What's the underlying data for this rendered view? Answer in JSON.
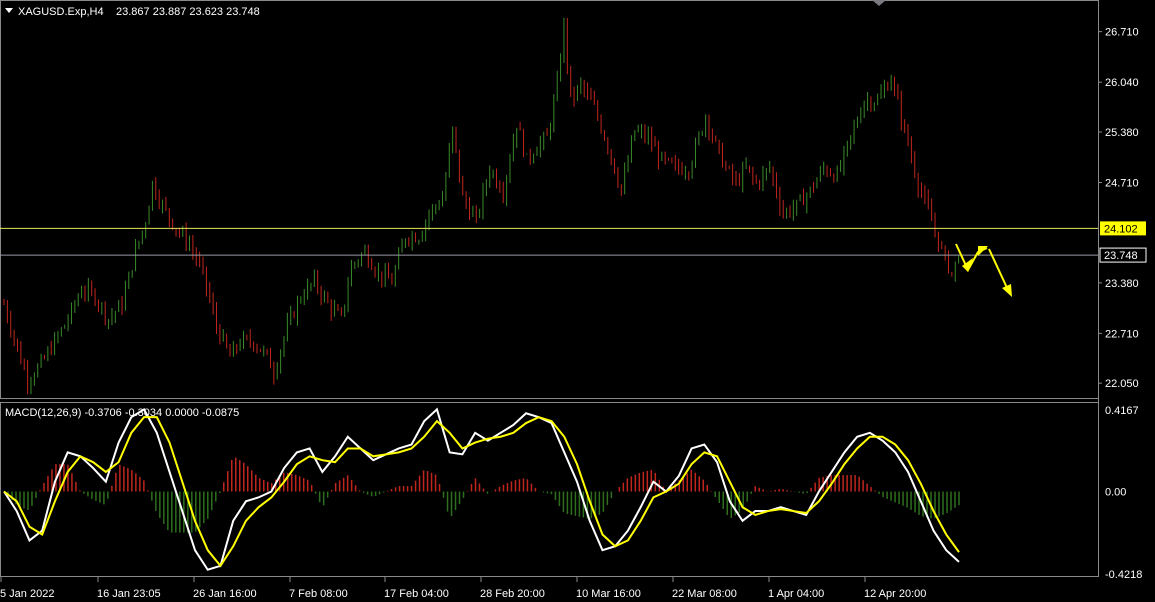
{
  "header": {
    "symbol_timeframe": "XAGUSD.Exp,H4",
    "ohlc": "23.867 23.887 23.623 23.748"
  },
  "macd_header": {
    "label": "MACD(12,26,9) -0.3706 -0.3034 0.0000 -0.0875"
  },
  "colors": {
    "background": "#000000",
    "bull_candle": "#3a8a2a",
    "bear_candle": "#c0261e",
    "hline_yellow": "#e6e65a",
    "hline_grey": "#9a9aa6",
    "macd_line": "#ffffff",
    "signal_line": "#ffff00",
    "hist_pos": "#c0261e",
    "hist_neg": "#2e6e1e",
    "arrow": "#ffff00"
  },
  "price_tags": {
    "yellow_level": "24.102",
    "current_price": "23.748"
  },
  "chart_data": [
    {
      "type": "candlestick",
      "name": "XAGUSD.Exp,H4",
      "yticks": [
        "26.710",
        "26.040",
        "25.380",
        "24.710",
        "23.380",
        "22.710",
        "22.050"
      ],
      "ylim": [
        21.88,
        27.05
      ],
      "xticks": [
        "5 Jan 2022",
        "16 Jan 23:05",
        "26 Jan 16:00",
        "7 Feb 08:00",
        "17 Feb 04:00",
        "28 Feb 20:00",
        "10 Mar 16:00",
        "22 Mar 08:00",
        "1 Apr 04:00",
        "12 Apr 20:00"
      ],
      "close_path": [
        [
          0,
          23.1
        ],
        [
          4,
          22.5
        ],
        [
          7,
          22.1
        ],
        [
          11,
          22.3
        ],
        [
          15,
          22.6
        ],
        [
          19,
          22.9
        ],
        [
          23,
          23.3
        ],
        [
          27,
          23.2
        ],
        [
          31,
          22.9
        ],
        [
          35,
          23.1
        ],
        [
          39,
          23.8
        ],
        [
          42,
          24.2
        ],
        [
          44,
          24.7
        ],
        [
          47,
          24.4
        ],
        [
          51,
          24.1
        ],
        [
          55,
          23.9
        ],
        [
          59,
          23.5
        ],
        [
          63,
          22.8
        ],
        [
          67,
          22.4
        ],
        [
          70,
          22.6
        ],
        [
          74,
          22.6
        ],
        [
          78,
          22.4
        ],
        [
          80,
          22.2
        ],
        [
          84,
          22.8
        ],
        [
          88,
          23.2
        ],
        [
          92,
          23.4
        ],
        [
          96,
          23.1
        ],
        [
          100,
          22.9
        ],
        [
          103,
          23.6
        ],
        [
          107,
          23.8
        ],
        [
          111,
          23.5
        ],
        [
          115,
          23.4
        ],
        [
          119,
          24.0
        ],
        [
          123,
          24.0
        ],
        [
          126,
          24.3
        ],
        [
          130,
          24.5
        ],
        [
          133,
          25.4
        ],
        [
          136,
          24.5
        ],
        [
          140,
          24.2
        ],
        [
          144,
          24.9
        ],
        [
          148,
          24.6
        ],
        [
          152,
          25.5
        ],
        [
          155,
          25.0
        ],
        [
          158,
          25.2
        ],
        [
          161,
          25.3
        ],
        [
          164,
          26.0
        ],
        [
          166,
          26.8
        ],
        [
          168,
          25.8
        ],
        [
          171,
          26.0
        ],
        [
          175,
          25.7
        ],
        [
          179,
          25.2
        ],
        [
          183,
          24.6
        ],
        [
          187,
          25.4
        ],
        [
          191,
          25.3
        ],
        [
          195,
          25.0
        ],
        [
          199,
          24.9
        ],
        [
          203,
          24.9
        ],
        [
          206,
          25.3
        ],
        [
          208,
          25.6
        ],
        [
          211,
          25.2
        ],
        [
          214,
          24.9
        ],
        [
          217,
          24.7
        ],
        [
          220,
          24.9
        ],
        [
          223,
          24.7
        ],
        [
          227,
          24.9
        ],
        [
          231,
          24.3
        ],
        [
          235,
          24.4
        ],
        [
          239,
          24.6
        ],
        [
          243,
          24.9
        ],
        [
          247,
          24.8
        ],
        [
          251,
          25.3
        ],
        [
          255,
          25.8
        ],
        [
          259,
          25.8
        ],
        [
          263,
          26.1
        ],
        [
          267,
          25.4
        ],
        [
          271,
          24.7
        ],
        [
          275,
          24.2
        ],
        [
          278,
          23.8
        ],
        [
          281,
          23.5
        ],
        [
          283,
          23.75
        ]
      ],
      "horizontal_levels": [
        24.102,
        23.748
      ]
    },
    {
      "type": "line",
      "name": "MACD(12,26,9)",
      "values_current": [
        -0.3706,
        -0.3034,
        0.0,
        -0.0875
      ],
      "yticks": [
        "0.4167",
        "0.00",
        "-0.4218"
      ],
      "ylim": [
        -0.4218,
        0.4167
      ],
      "series": [
        {
          "name": "MACD",
          "values": [
            0.0,
            -0.1,
            -0.25,
            -0.2,
            0.05,
            0.2,
            0.18,
            0.12,
            0.05,
            0.25,
            0.38,
            0.42,
            0.3,
            0.1,
            -0.1,
            -0.3,
            -0.4,
            -0.38,
            -0.15,
            -0.05,
            -0.03,
            0.0,
            0.12,
            0.2,
            0.22,
            0.1,
            0.18,
            0.28,
            0.22,
            0.16,
            0.19,
            0.22,
            0.24,
            0.36,
            0.42,
            0.2,
            0.19,
            0.3,
            0.26,
            0.3,
            0.34,
            0.4,
            0.38,
            0.35,
            0.2,
            0.05,
            -0.15,
            -0.3,
            -0.28,
            -0.2,
            -0.08,
            0.05,
            0.0,
            0.08,
            0.22,
            0.24,
            0.15,
            -0.05,
            -0.15,
            -0.1,
            -0.1,
            -0.08,
            -0.1,
            -0.12,
            0.0,
            0.1,
            0.2,
            0.28,
            0.3,
            0.26,
            0.2,
            0.1,
            -0.05,
            -0.2,
            -0.3,
            -0.36
          ]
        },
        {
          "name": "Signal",
          "values": [
            0.0,
            -0.05,
            -0.18,
            -0.22,
            -0.05,
            0.1,
            0.18,
            0.15,
            0.1,
            0.15,
            0.3,
            0.38,
            0.38,
            0.25,
            0.05,
            -0.15,
            -0.3,
            -0.38,
            -0.28,
            -0.15,
            -0.08,
            -0.03,
            0.05,
            0.14,
            0.18,
            0.16,
            0.15,
            0.22,
            0.22,
            0.18,
            0.19,
            0.2,
            0.22,
            0.28,
            0.36,
            0.3,
            0.22,
            0.25,
            0.27,
            0.28,
            0.3,
            0.35,
            0.38,
            0.36,
            0.28,
            0.14,
            -0.05,
            -0.22,
            -0.28,
            -0.25,
            -0.15,
            -0.03,
            0.0,
            0.04,
            0.14,
            0.2,
            0.18,
            0.05,
            -0.08,
            -0.12,
            -0.1,
            -0.09,
            -0.1,
            -0.11,
            -0.05,
            0.04,
            0.14,
            0.22,
            0.28,
            0.28,
            0.24,
            0.16,
            0.04,
            -0.1,
            -0.22,
            -0.31
          ]
        }
      ]
    }
  ]
}
